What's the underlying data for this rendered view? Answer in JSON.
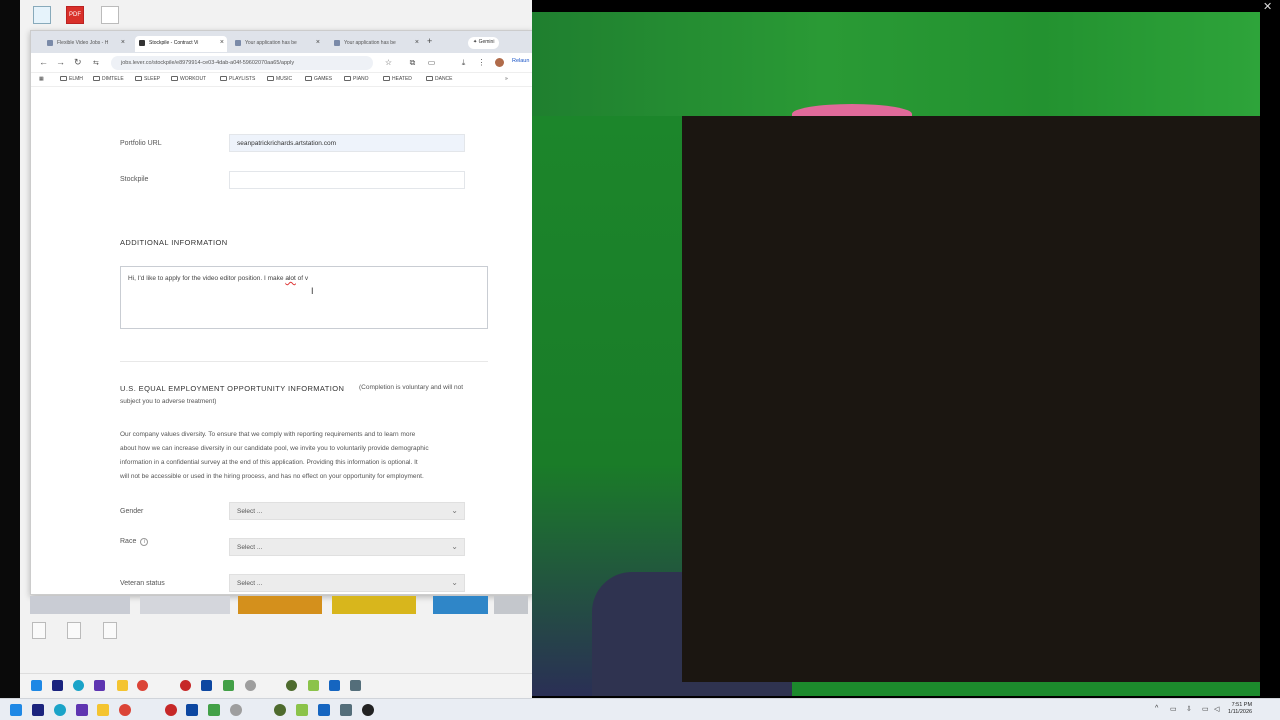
{
  "browser": {
    "tabs": [
      {
        "label": "Flexible Video Jobs - H",
        "active": false
      },
      {
        "label": "Stockpile - Contract Vi",
        "active": true
      },
      {
        "label": "Your application has be",
        "active": false
      },
      {
        "label": "Your application has be",
        "active": false
      }
    ],
    "gemini_label": "Gemini",
    "url": "jobs.lever.co/stockpile/e8979914-ce03-4dab-a04f-59602070aa65/apply",
    "relaunch_label": "Relaun",
    "bookmarks": [
      "ELMH",
      "DIMTELE",
      "SLEEP",
      "WORKOUT",
      "PLAYLISTS",
      "MUSIC",
      "GAMES",
      "PIANO",
      "HEATED",
      "DANCE"
    ]
  },
  "form": {
    "portfolio_label": "Portfolio URL",
    "portfolio_value": "seanpatrickrichards.artstation.com",
    "stockpile_label": "Stockpile",
    "stockpile_value": "",
    "additional_title": "ADDITIONAL INFORMATION",
    "additional_text_before": "Hi, I'd like to apply for the video editor position. I make ",
    "additional_text_misspelled": "alot",
    "additional_text_after": " of v",
    "eeo_title": "U.S. EQUAL EMPLOYMENT OPPORTUNITY INFORMATION",
    "eeo_note_part1": "(Completion is voluntary and will not",
    "eeo_note_part2": "subject you to adverse treatment)",
    "diversity_lines": [
      "Our company values diversity. To ensure that we comply with reporting requirements and to learn more",
      "about how we can increase diversity in our candidate pool, we invite you to voluntarily provide demographic",
      "information in a confidential survey at the end of this application. Providing this information is optional. It",
      "will not be accessible or used in the hiring process, and has no effect on your opportunity for employment."
    ],
    "gender_label": "Gender",
    "gender_value": "Select ...",
    "race_label": "Race",
    "race_value": "Select ...",
    "veteran_label": "Veteran status",
    "veteran_value": "Select ..."
  },
  "desktop": {
    "pdf_label": "PDF"
  },
  "taskbar": {
    "time": "7:51 PM",
    "date": "1/11/2026"
  }
}
